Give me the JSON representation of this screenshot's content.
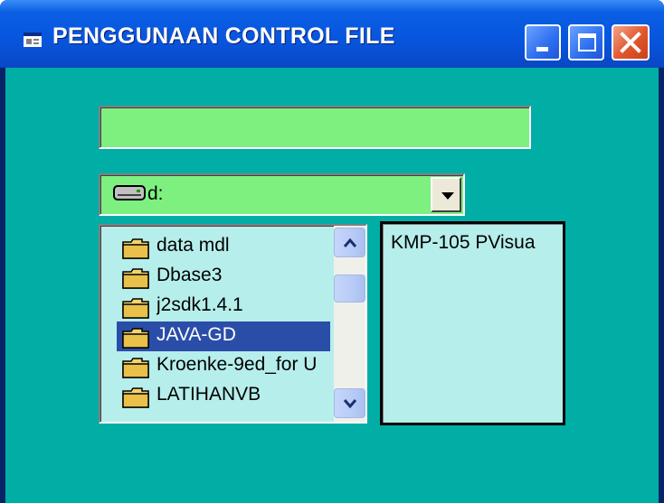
{
  "window": {
    "title": "PENGGUNAAN CONTROL FILE",
    "minimize_label": "Minimize",
    "maximize_label": "Maximize",
    "close_label": "Close"
  },
  "textbox": {
    "value": ""
  },
  "drive": {
    "selected": "d:",
    "options": [
      "d:"
    ]
  },
  "dirlist": {
    "items": [
      {
        "label": "data mdl",
        "selected": false
      },
      {
        "label": "Dbase3",
        "selected": false
      },
      {
        "label": "j2sdk1.4.1",
        "selected": false
      },
      {
        "label": "JAVA-GD",
        "selected": true
      },
      {
        "label": "Kroenke-9ed_for U",
        "selected": false
      },
      {
        "label": "LATIHANVB",
        "selected": false
      }
    ]
  },
  "filelist": {
    "items": [
      "KMP-105 PVisua"
    ]
  },
  "colors": {
    "client_bg": "#00aea6",
    "field_bg": "#7df080",
    "list_bg": "#b6eeec",
    "selection": "#2a4ea8"
  }
}
